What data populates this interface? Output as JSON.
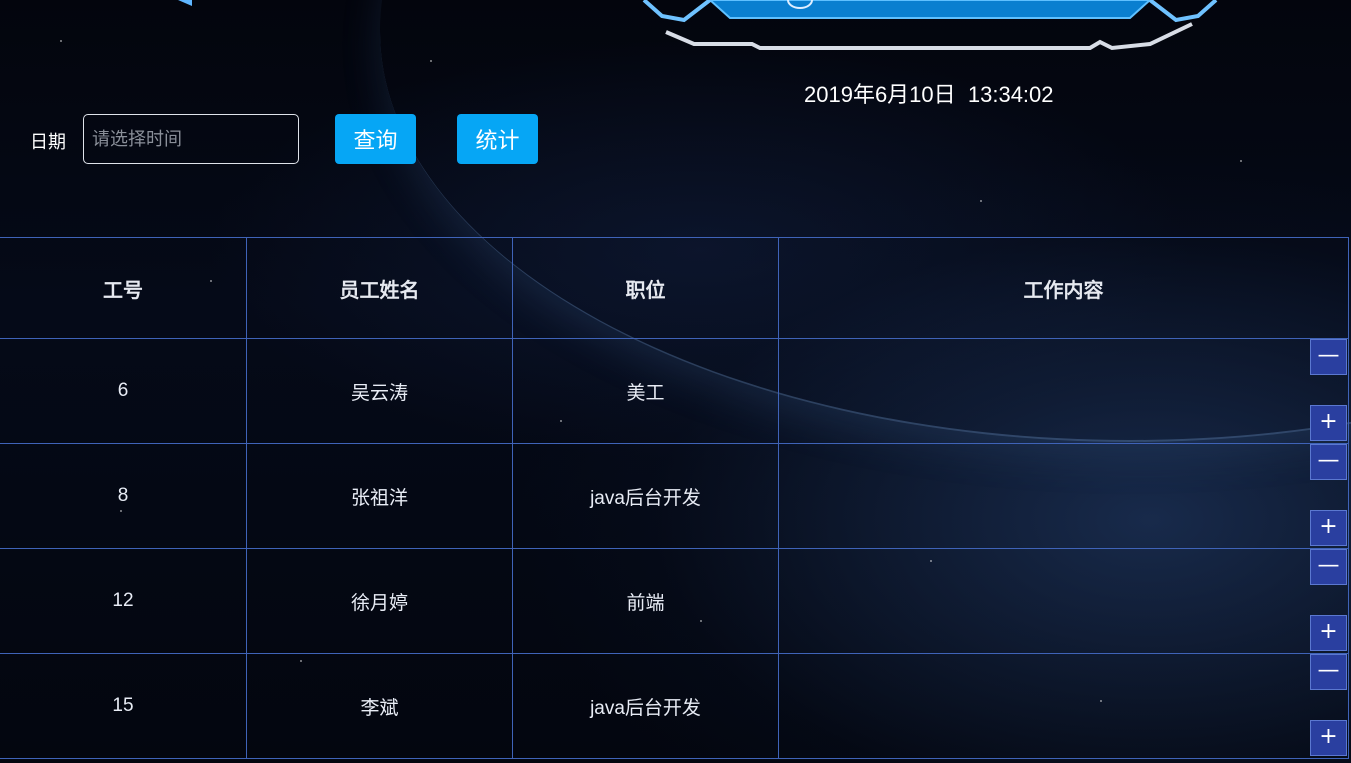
{
  "datetime": "2019年6月10日  13:34:02",
  "toolbar": {
    "date_label": "日期",
    "date_placeholder": "请选择时间",
    "query_label": "查询",
    "stat_label": "统计"
  },
  "table": {
    "headers": [
      "工号",
      "员工姓名",
      "职位",
      "工作内容"
    ],
    "rows": [
      {
        "id": "6",
        "name": "吴云涛",
        "position": "美工",
        "content": ""
      },
      {
        "id": "8",
        "name": "张祖洋",
        "position": "java后台开发",
        "content": ""
      },
      {
        "id": "12",
        "name": "徐月婷",
        "position": "前端",
        "content": ""
      },
      {
        "id": "15",
        "name": "李斌",
        "position": "java后台开发",
        "content": ""
      }
    ]
  },
  "controls": {
    "minus_symbol": "—",
    "plus_symbol": "+"
  },
  "colors": {
    "accent": "#06a6f5",
    "table_border": "#3f63b8",
    "control_bg": "#2a3fa0"
  }
}
